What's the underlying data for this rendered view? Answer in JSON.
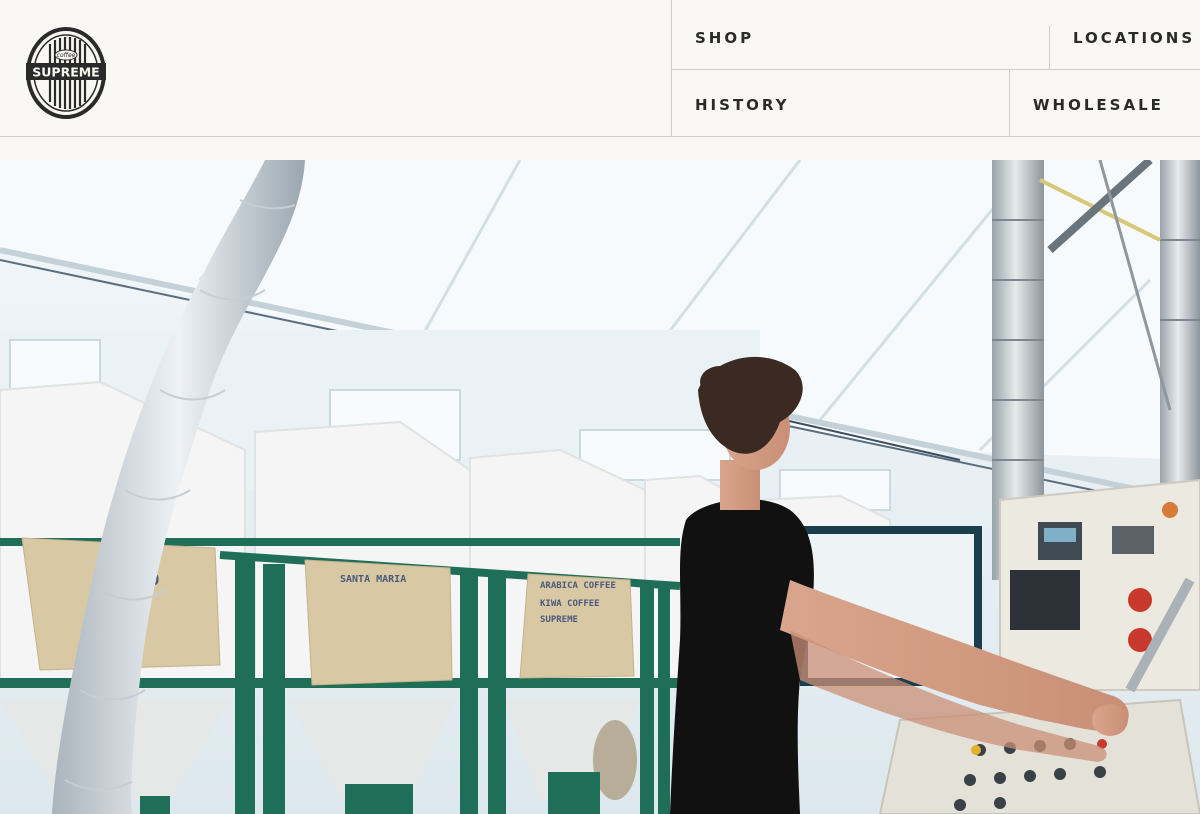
{
  "brand": {
    "logo_small_text": "coffee",
    "logo_main_text": "SUPREME"
  },
  "nav": {
    "shop": "SHOP",
    "locations": "LOCATIONS",
    "history": "HISTORY",
    "wholesale": "WHOLESALE"
  },
  "hero": {
    "sack_1": "TO",
    "sack_2": "SANTA MARIA",
    "sack_3_line1": "ARABICA COFFEE",
    "sack_3_line2": "KIWA COFFEE",
    "sack_3_line3": "SUPREME"
  },
  "colors": {
    "background": "#f9f8f4",
    "text": "#2a2a2a",
    "divider": "#cfcdc6",
    "frame_green": "#1f6e57",
    "shirt": "#111111"
  }
}
